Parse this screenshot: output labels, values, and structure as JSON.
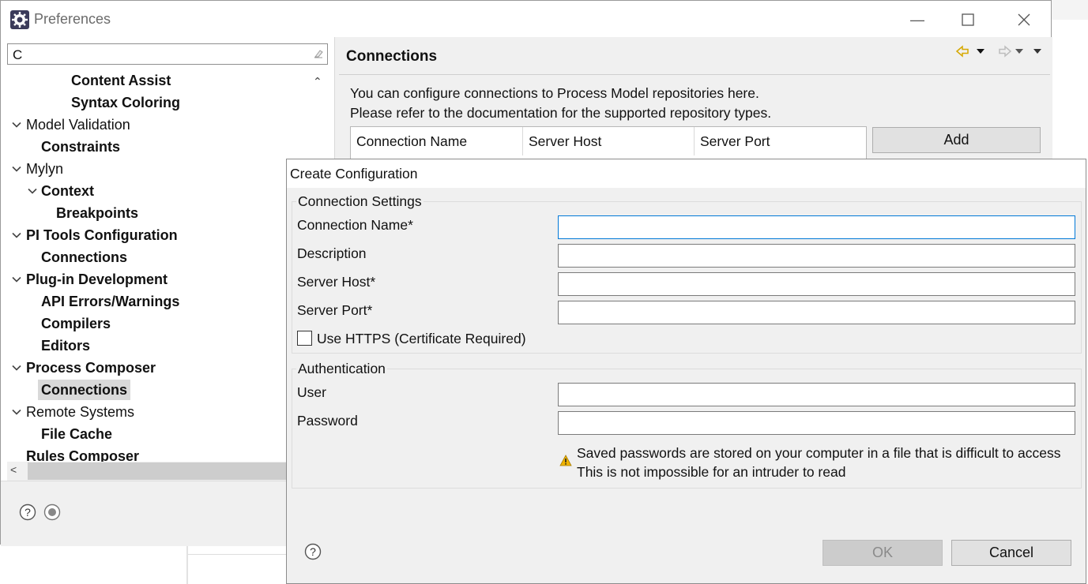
{
  "window": {
    "title": "Preferences"
  },
  "filter": {
    "value": "C"
  },
  "tree": [
    {
      "label": "Content Assist",
      "bold": true,
      "twisty": ""
    },
    {
      "label": "Syntax Coloring",
      "bold": true,
      "twisty": ""
    },
    {
      "label": "Model Validation",
      "bold": false,
      "twisty": "v"
    },
    {
      "label": "Constraints",
      "bold": true,
      "twisty": ""
    },
    {
      "label": "Mylyn",
      "bold": false,
      "twisty": "v"
    },
    {
      "label": "Context",
      "bold": true,
      "twisty": "v"
    },
    {
      "label": "Breakpoints",
      "bold": true,
      "twisty": ""
    },
    {
      "label": "PI Tools Configuration",
      "bold": true,
      "twisty": "v"
    },
    {
      "label": "Connections",
      "bold": true,
      "twisty": ""
    },
    {
      "label": "Plug-in Development",
      "bold": true,
      "twisty": "v"
    },
    {
      "label": "API Errors/Warnings",
      "bold": true,
      "twisty": ""
    },
    {
      "label": "Compilers",
      "bold": true,
      "twisty": ""
    },
    {
      "label": "Editors",
      "bold": true,
      "twisty": ""
    },
    {
      "label": "Process Composer",
      "bold": true,
      "twisty": "v"
    },
    {
      "label": "Connections",
      "bold": true,
      "twisty": "",
      "selected": true
    },
    {
      "label": "Remote Systems",
      "bold": false,
      "twisty": "v"
    },
    {
      "label": "File Cache",
      "bold": true,
      "twisty": ""
    },
    {
      "label": "Rules Composer",
      "bold": true,
      "twisty": ""
    }
  ],
  "page": {
    "title": "Connections",
    "description_1": "You can configure connections to Process Model repositories here.",
    "description_2": "Please refer to the documentation for the supported repository types.",
    "columns": [
      "Connection Name",
      "Server Host",
      "Server Port"
    ],
    "add_label": "Add"
  },
  "dialog": {
    "title": "Create Configuration",
    "connection_group": "Connection Settings",
    "connection_name_label": "Connection Name*",
    "description_label": "Description",
    "server_host_label": "Server Host*",
    "server_port_label": "Server Port*",
    "https_label": "Use HTTPS (Certificate Required)",
    "auth_group": "Authentication",
    "user_label": "User",
    "password_label": "Password",
    "warning_1": "Saved passwords are stored on your computer in a file that is difficult to access",
    "warning_2": "This is not impossible for an intruder to read",
    "ok_label": "OK",
    "cancel_label": "Cancel"
  },
  "icons": {
    "app": "eclipse-gear-icon",
    "help": "help-icon",
    "import": "import-export-icon",
    "warning": "warning-icon"
  },
  "colors": {
    "focus_border": "#0078d7",
    "selection": "#d9d9d9",
    "warning": "#f0b400"
  }
}
